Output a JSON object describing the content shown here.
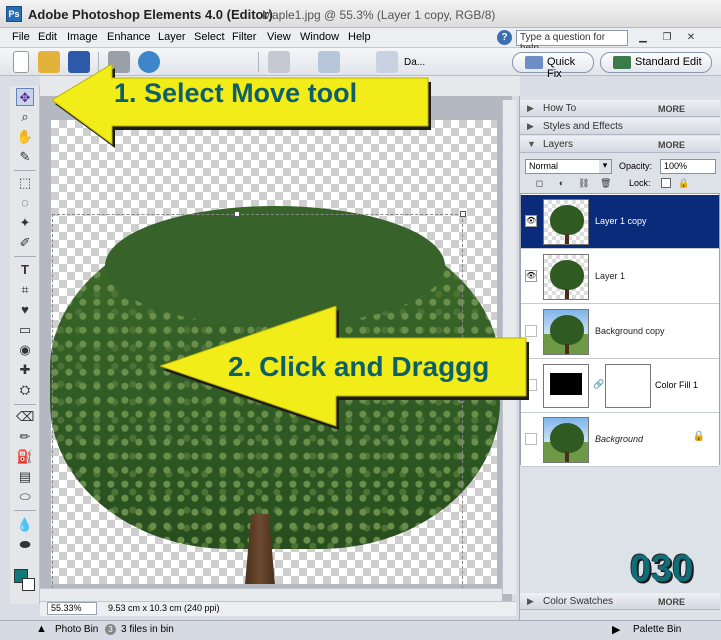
{
  "window": {
    "app_title": "Adobe Photoshop Elements 4.0 (Editor)",
    "doc_title": "Maple1.jpg @ 55.3% (Layer 1 copy, RGB/8)"
  },
  "menu": [
    "File",
    "Edit",
    "Image",
    "Enhance",
    "Layer",
    "Select",
    "Filter",
    "View",
    "Window",
    "Help"
  ],
  "help": {
    "placeholder": "Type a question for help"
  },
  "toolbar": {
    "da_label": "Da...",
    "quick_fix": "Quick Fix",
    "standard_edit": "Standard Edit"
  },
  "status": {
    "zoom": "55.33%",
    "doc_size": "9.53 cm x 10.3 cm (240 ppi)"
  },
  "bottom": {
    "photo_bin": "Photo Bin",
    "files_count": "3",
    "files_label": "3 files in bin",
    "palette_bin": "Palette Bin"
  },
  "panels": {
    "how_to": "How To",
    "styles": "Styles and Effects",
    "layers": "Layers",
    "more": "MORE",
    "color_swatches": "Color Swatches"
  },
  "layers": {
    "blend_mode": "Normal",
    "opacity_label": "Opacity:",
    "opacity_value": "100%",
    "lock_label": "Lock:",
    "items": [
      {
        "name": "Layer 1 copy",
        "selected": true
      },
      {
        "name": "Layer 1"
      },
      {
        "name": "Background copy"
      },
      {
        "name": "Color Fill 1"
      },
      {
        "name": "Background"
      }
    ]
  },
  "annotations": {
    "step1": "1. Select Move tool",
    "step2": "2. Click and Draggg",
    "number": "030"
  },
  "colors": {
    "accent_teal": "#0e6f7a",
    "callout_yellow": "#f2ec19",
    "selected_layer": "#0a2a7a",
    "foreground": "#0f7a7a"
  }
}
